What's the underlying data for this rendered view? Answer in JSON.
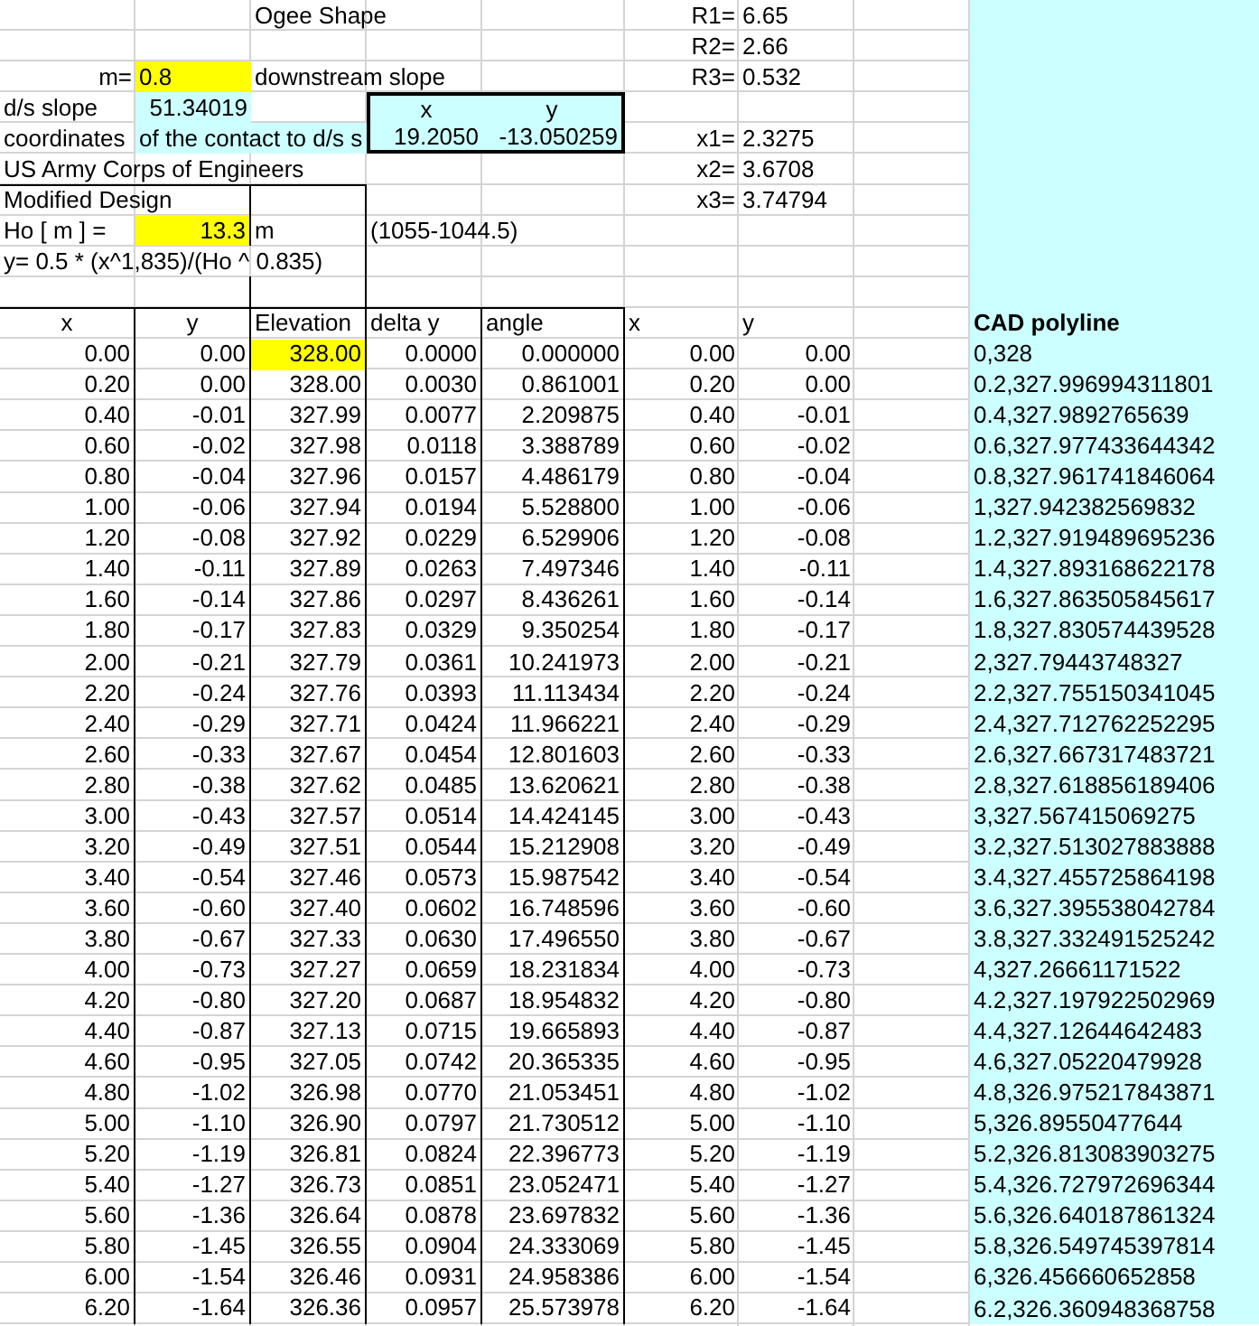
{
  "title": "Ogee Shape",
  "radii": [
    {
      "label": "R1=",
      "value": "6.65"
    },
    {
      "label": "R2=",
      "value": "2.66"
    },
    {
      "label": "R3=",
      "value": "0.532"
    }
  ],
  "slope": {
    "label": "m=",
    "value": "0.8",
    "note": "downstream slope"
  },
  "ds_slope": {
    "label": "d/s slope",
    "value": "51.34019"
  },
  "contact": {
    "label": "coordinates",
    "label_continued": "of the contact to d/s s",
    "columns": [
      "x",
      "y"
    ],
    "values": [
      "19.2050",
      "-13.050259"
    ]
  },
  "x_points": [
    {
      "label": "x1=",
      "value": "2.3275"
    },
    {
      "label": "x2=",
      "value": "3.6708"
    },
    {
      "label": "x3=",
      "value": "3.74794"
    }
  ],
  "source": "US Army Corps of Engineers",
  "design": {
    "title": "Modified Design",
    "head_label": "Ho [ m ] =",
    "head_value": "13.3",
    "head_unit": "m",
    "head_note": "(1055-1044.5)",
    "equation": "y= 0.5 * (x^1,835)/(Ho ^ 0.835)"
  },
  "table": {
    "columns": [
      "x",
      "y",
      "Elevation",
      "delta y",
      "angle",
      "x",
      "y"
    ],
    "rows": [
      [
        "0.00",
        "0.00",
        "328.00",
        "0.0000",
        "0.000000",
        "0.00",
        "0.00"
      ],
      [
        "0.20",
        "0.00",
        "328.00",
        "0.0030",
        "0.861001",
        "0.20",
        "0.00"
      ],
      [
        "0.40",
        "-0.01",
        "327.99",
        "0.0077",
        "2.209875",
        "0.40",
        "-0.01"
      ],
      [
        "0.60",
        "-0.02",
        "327.98",
        "0.0118",
        "3.388789",
        "0.60",
        "-0.02"
      ],
      [
        "0.80",
        "-0.04",
        "327.96",
        "0.0157",
        "4.486179",
        "0.80",
        "-0.04"
      ],
      [
        "1.00",
        "-0.06",
        "327.94",
        "0.0194",
        "5.528800",
        "1.00",
        "-0.06"
      ],
      [
        "1.20",
        "-0.08",
        "327.92",
        "0.0229",
        "6.529906",
        "1.20",
        "-0.08"
      ],
      [
        "1.40",
        "-0.11",
        "327.89",
        "0.0263",
        "7.497346",
        "1.40",
        "-0.11"
      ],
      [
        "1.60",
        "-0.14",
        "327.86",
        "0.0297",
        "8.436261",
        "1.60",
        "-0.14"
      ],
      [
        "1.80",
        "-0.17",
        "327.83",
        "0.0329",
        "9.350254",
        "1.80",
        "-0.17"
      ],
      [
        "2.00",
        "-0.21",
        "327.79",
        "0.0361",
        "10.241973",
        "2.00",
        "-0.21"
      ],
      [
        "2.20",
        "-0.24",
        "327.76",
        "0.0393",
        "11.113434",
        "2.20",
        "-0.24"
      ],
      [
        "2.40",
        "-0.29",
        "327.71",
        "0.0424",
        "11.966221",
        "2.40",
        "-0.29"
      ],
      [
        "2.60",
        "-0.33",
        "327.67",
        "0.0454",
        "12.801603",
        "2.60",
        "-0.33"
      ],
      [
        "2.80",
        "-0.38",
        "327.62",
        "0.0485",
        "13.620621",
        "2.80",
        "-0.38"
      ],
      [
        "3.00",
        "-0.43",
        "327.57",
        "0.0514",
        "14.424145",
        "3.00",
        "-0.43"
      ],
      [
        "3.20",
        "-0.49",
        "327.51",
        "0.0544",
        "15.212908",
        "3.20",
        "-0.49"
      ],
      [
        "3.40",
        "-0.54",
        "327.46",
        "0.0573",
        "15.987542",
        "3.40",
        "-0.54"
      ],
      [
        "3.60",
        "-0.60",
        "327.40",
        "0.0602",
        "16.748596",
        "3.60",
        "-0.60"
      ],
      [
        "3.80",
        "-0.67",
        "327.33",
        "0.0630",
        "17.496550",
        "3.80",
        "-0.67"
      ],
      [
        "4.00",
        "-0.73",
        "327.27",
        "0.0659",
        "18.231834",
        "4.00",
        "-0.73"
      ],
      [
        "4.20",
        "-0.80",
        "327.20",
        "0.0687",
        "18.954832",
        "4.20",
        "-0.80"
      ],
      [
        "4.40",
        "-0.87",
        "327.13",
        "0.0715",
        "19.665893",
        "4.40",
        "-0.87"
      ],
      [
        "4.60",
        "-0.95",
        "327.05",
        "0.0742",
        "20.365335",
        "4.60",
        "-0.95"
      ],
      [
        "4.80",
        "-1.02",
        "326.98",
        "0.0770",
        "21.053451",
        "4.80",
        "-1.02"
      ],
      [
        "5.00",
        "-1.10",
        "326.90",
        "0.0797",
        "21.730512",
        "5.00",
        "-1.10"
      ],
      [
        "5.20",
        "-1.19",
        "326.81",
        "0.0824",
        "22.396773",
        "5.20",
        "-1.19"
      ],
      [
        "5.40",
        "-1.27",
        "326.73",
        "0.0851",
        "23.052471",
        "5.40",
        "-1.27"
      ],
      [
        "5.60",
        "-1.36",
        "326.64",
        "0.0878",
        "23.697832",
        "5.60",
        "-1.36"
      ],
      [
        "5.80",
        "-1.45",
        "326.55",
        "0.0904",
        "24.333069",
        "5.80",
        "-1.45"
      ],
      [
        "6.00",
        "-1.54",
        "326.46",
        "0.0931",
        "24.958386",
        "6.00",
        "-1.54"
      ],
      [
        "6.20",
        "-1.64",
        "326.36",
        "0.0957",
        "25.573978",
        "6.20",
        "-1.64"
      ]
    ]
  },
  "cad_polyline": {
    "title": "CAD polyline",
    "rows": [
      "0,328",
      "0.2,327.996994311801",
      "0.4,327.9892765639",
      "0.6,327.977433644342",
      "0.8,327.961741846064",
      "1,327.942382569832",
      "1.2,327.919489695236",
      "1.4,327.893168622178",
      "1.6,327.863505845617",
      "1.8,327.830574439528",
      "2,327.79443748327",
      "2.2,327.755150341045",
      "2.4,327.712762252295",
      "2.6,327.667317483721",
      "2.8,327.618856189406",
      "3,327.567415069275",
      "3.2,327.513027883888",
      "3.4,327.455725864198",
      "3.6,327.395538042784",
      "3.8,327.332491525242",
      "4,327.26661171522",
      "4.2,327.197922502969",
      "4.4,327.12644642483",
      "4.6,327.05220479928",
      "4.8,326.975217843871",
      "5,326.89550477644",
      "5.2,326.813083903275",
      "5.4,326.727972696344",
      "5.6,326.640187861324",
      "5.8,326.549745397814",
      "6,326.456660652858",
      "6.2,326.360948368758"
    ]
  }
}
